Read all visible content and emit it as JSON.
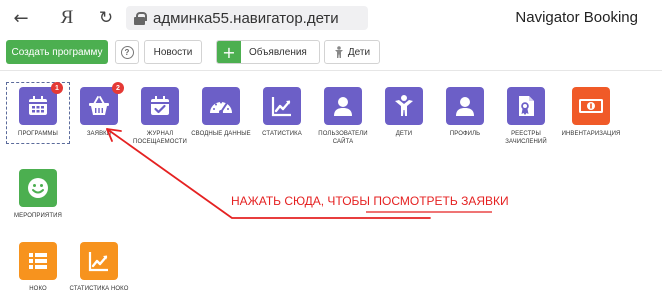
{
  "browser": {
    "url": "админка55.навигатор.дети",
    "title": "Navigator Booking",
    "yandex_glyph": "Я"
  },
  "toolbar": {
    "create_label": "Создать программу",
    "help_glyph": "?",
    "news_label": "Новости",
    "ads_label": "Объявления",
    "kids_label": "Дети"
  },
  "tiles": [
    {
      "label": "ПРОГРАММЫ",
      "icon": "calendar-icon",
      "color": "#6c5fc7",
      "badge": "1"
    },
    {
      "label": "ЗАЯВКИ",
      "icon": "basket-icon",
      "color": "#6c5fc7",
      "badge": "2"
    },
    {
      "label": "ЖУРНАЛ ПОСЕЩАЕМОСТИ",
      "icon": "calendar-check-icon",
      "color": "#6c5fc7"
    },
    {
      "label": "СВОДНЫЕ ДАННЫЕ",
      "icon": "gauge-icon",
      "color": "#6c5fc7"
    },
    {
      "label": "СТАТИСТИКА",
      "icon": "chart-line-icon",
      "color": "#6c5fc7"
    },
    {
      "label": "ПОЛЬЗОВАТЕЛИ САЙТА",
      "icon": "user-icon",
      "color": "#6c5fc7"
    },
    {
      "label": "ДЕТИ",
      "icon": "child-icon",
      "color": "#6c5fc7"
    },
    {
      "label": "ПРОФИЛЬ",
      "icon": "profile-icon",
      "color": "#6c5fc7"
    },
    {
      "label": "РЕЕСТРЫ ЗАЧИСЛЕНИЙ",
      "icon": "certificate-icon",
      "color": "#6c5fc7"
    },
    {
      "label": "ИНВЕНТАРИЗАЦИЯ",
      "icon": "money-icon",
      "color": "#f05a28"
    },
    {
      "label": "МЕРОПРИЯТИЯ",
      "icon": "smile-icon",
      "color": "#4caf50"
    },
    {
      "label": "НОКО",
      "icon": "list-icon",
      "color": "#f7931e"
    },
    {
      "label": "СТАТИСТИКА НОКО",
      "icon": "chart-line-icon",
      "color": "#f7931e"
    }
  ],
  "annotation": {
    "text_prefix": "НАЖАТЬ СЮДА, ЧТОБЫ ",
    "text_underlined": "ПОСМОТРЕТЬ ЗАЯВКИ",
    "color": "#e52222"
  }
}
